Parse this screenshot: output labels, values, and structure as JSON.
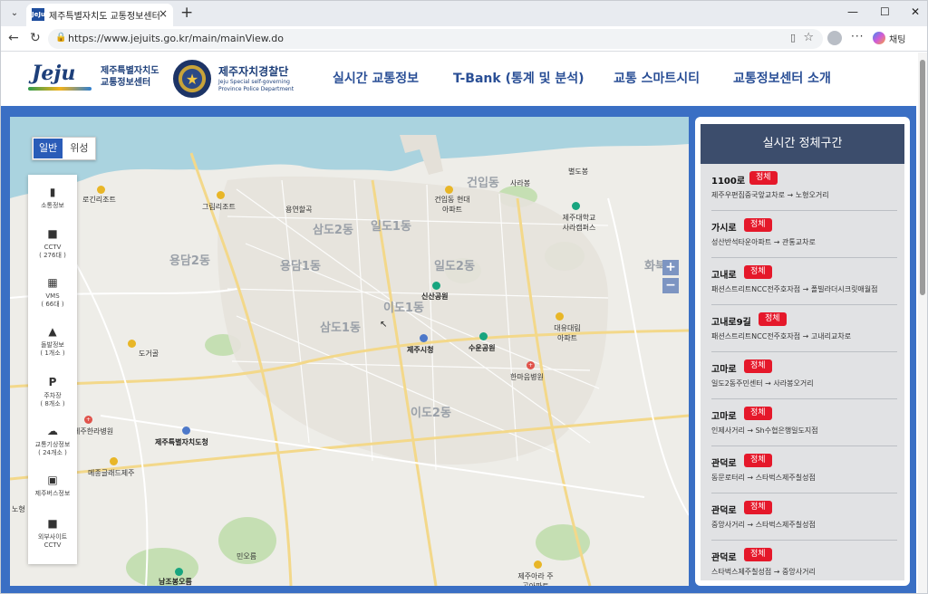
{
  "browser": {
    "tab_title": "제주특별자치도 교통정보센터",
    "favicon_text": "JeJu",
    "url": "https://www.jejuits.go.kr/main/mainView.do",
    "chat_label": "채팅"
  },
  "header": {
    "jeju_logo_text": "Jeju",
    "jeju_org_line1": "제주특별자치도",
    "jeju_org_line2": "교통정보센터",
    "police_name": "제주자치경찰단",
    "police_sub1": "Jeju Special self-governing",
    "police_sub2": "Province Police Department",
    "nav": [
      "실시간 교통정보",
      "T-Bank (통계 및 분석)",
      "교통 스마트시티",
      "교통정보센터 소개"
    ]
  },
  "map": {
    "toggle": {
      "normal": "일반",
      "satellite": "위성"
    },
    "menu": [
      {
        "icon": "traffic-light-icon",
        "label": "소통정보",
        "count": ""
      },
      {
        "icon": "cctv-icon",
        "label": "CCTV",
        "count": "( 276대 )"
      },
      {
        "icon": "vms-icon",
        "label": "VMS",
        "count": "( 66대 )"
      },
      {
        "icon": "warning-icon",
        "label": "돌발정보",
        "count": "( 1개소 )"
      },
      {
        "icon": "parking-icon",
        "label": "주차장",
        "count": "( 8개소 )"
      },
      {
        "icon": "weather-car-icon",
        "label": "교통기상정보",
        "count": "( 24개소 )"
      },
      {
        "icon": "bus-icon",
        "label": "제주버스정보",
        "count": ""
      },
      {
        "icon": "external-cctv-icon",
        "label": "외부사이트",
        "count": "CCTV"
      }
    ],
    "labels": {
      "l1": "로긴리조트",
      "l2": "그림리조트",
      "l3": "용연할곡",
      "l4": "건입동",
      "l5": "사라봉",
      "l6": "별도봉",
      "l7": "건입동 현대아파트",
      "l8": "제주대학교 사라캠퍼스",
      "l9": "삼도2동",
      "l10": "일도1동",
      "l11": "용담2동",
      "l12": "용담1동",
      "l13": "일도2동",
      "l14": "신산공원",
      "l15": "이도1동",
      "l16": "삼도1동",
      "l17": "대유대림 아파트",
      "l18": "제주시청",
      "l19": "수운공원",
      "l20": "도거골",
      "l21": "한마음병원",
      "l22": "이도2동",
      "l23": "제주한라병원",
      "l24": "제주특별자치도청",
      "l25": "메종글래드제주",
      "l26": "민오름",
      "l27": "남조봉오름",
      "l28": "제주아라 주공아파트",
      "l29": "화북",
      "l30": "노형"
    }
  },
  "panel": {
    "title": "실시간 정체구간",
    "status_label": "정체",
    "roads": [
      {
        "name": "1100로",
        "route": "제주우편집중국앞교차로 → 노형오거리"
      },
      {
        "name": "가시로",
        "route": "성산반석타운아파트 → 관통교차로"
      },
      {
        "name": "고내로",
        "route": "패션스트리트NCC전주호자점 → 폴빌라더시크릿애월점"
      },
      {
        "name": "고내로9길",
        "route": "패션스트리트NCC전주호자점 → 고내리교차로"
      },
      {
        "name": "고마로",
        "route": "일도2동주민센터 → 사라봉오거리"
      },
      {
        "name": "고마로",
        "route": "인제사거리 → Sh수협은행일도지점"
      },
      {
        "name": "관덕로",
        "route": "동문로터리 → 스타벅스제주칠성점"
      },
      {
        "name": "관덕로",
        "route": "중앙사거리 → 스타벅스제주칠성점"
      },
      {
        "name": "관덕로",
        "route": "스타벅스제주칠성점 → 중앙사거리"
      }
    ]
  }
}
